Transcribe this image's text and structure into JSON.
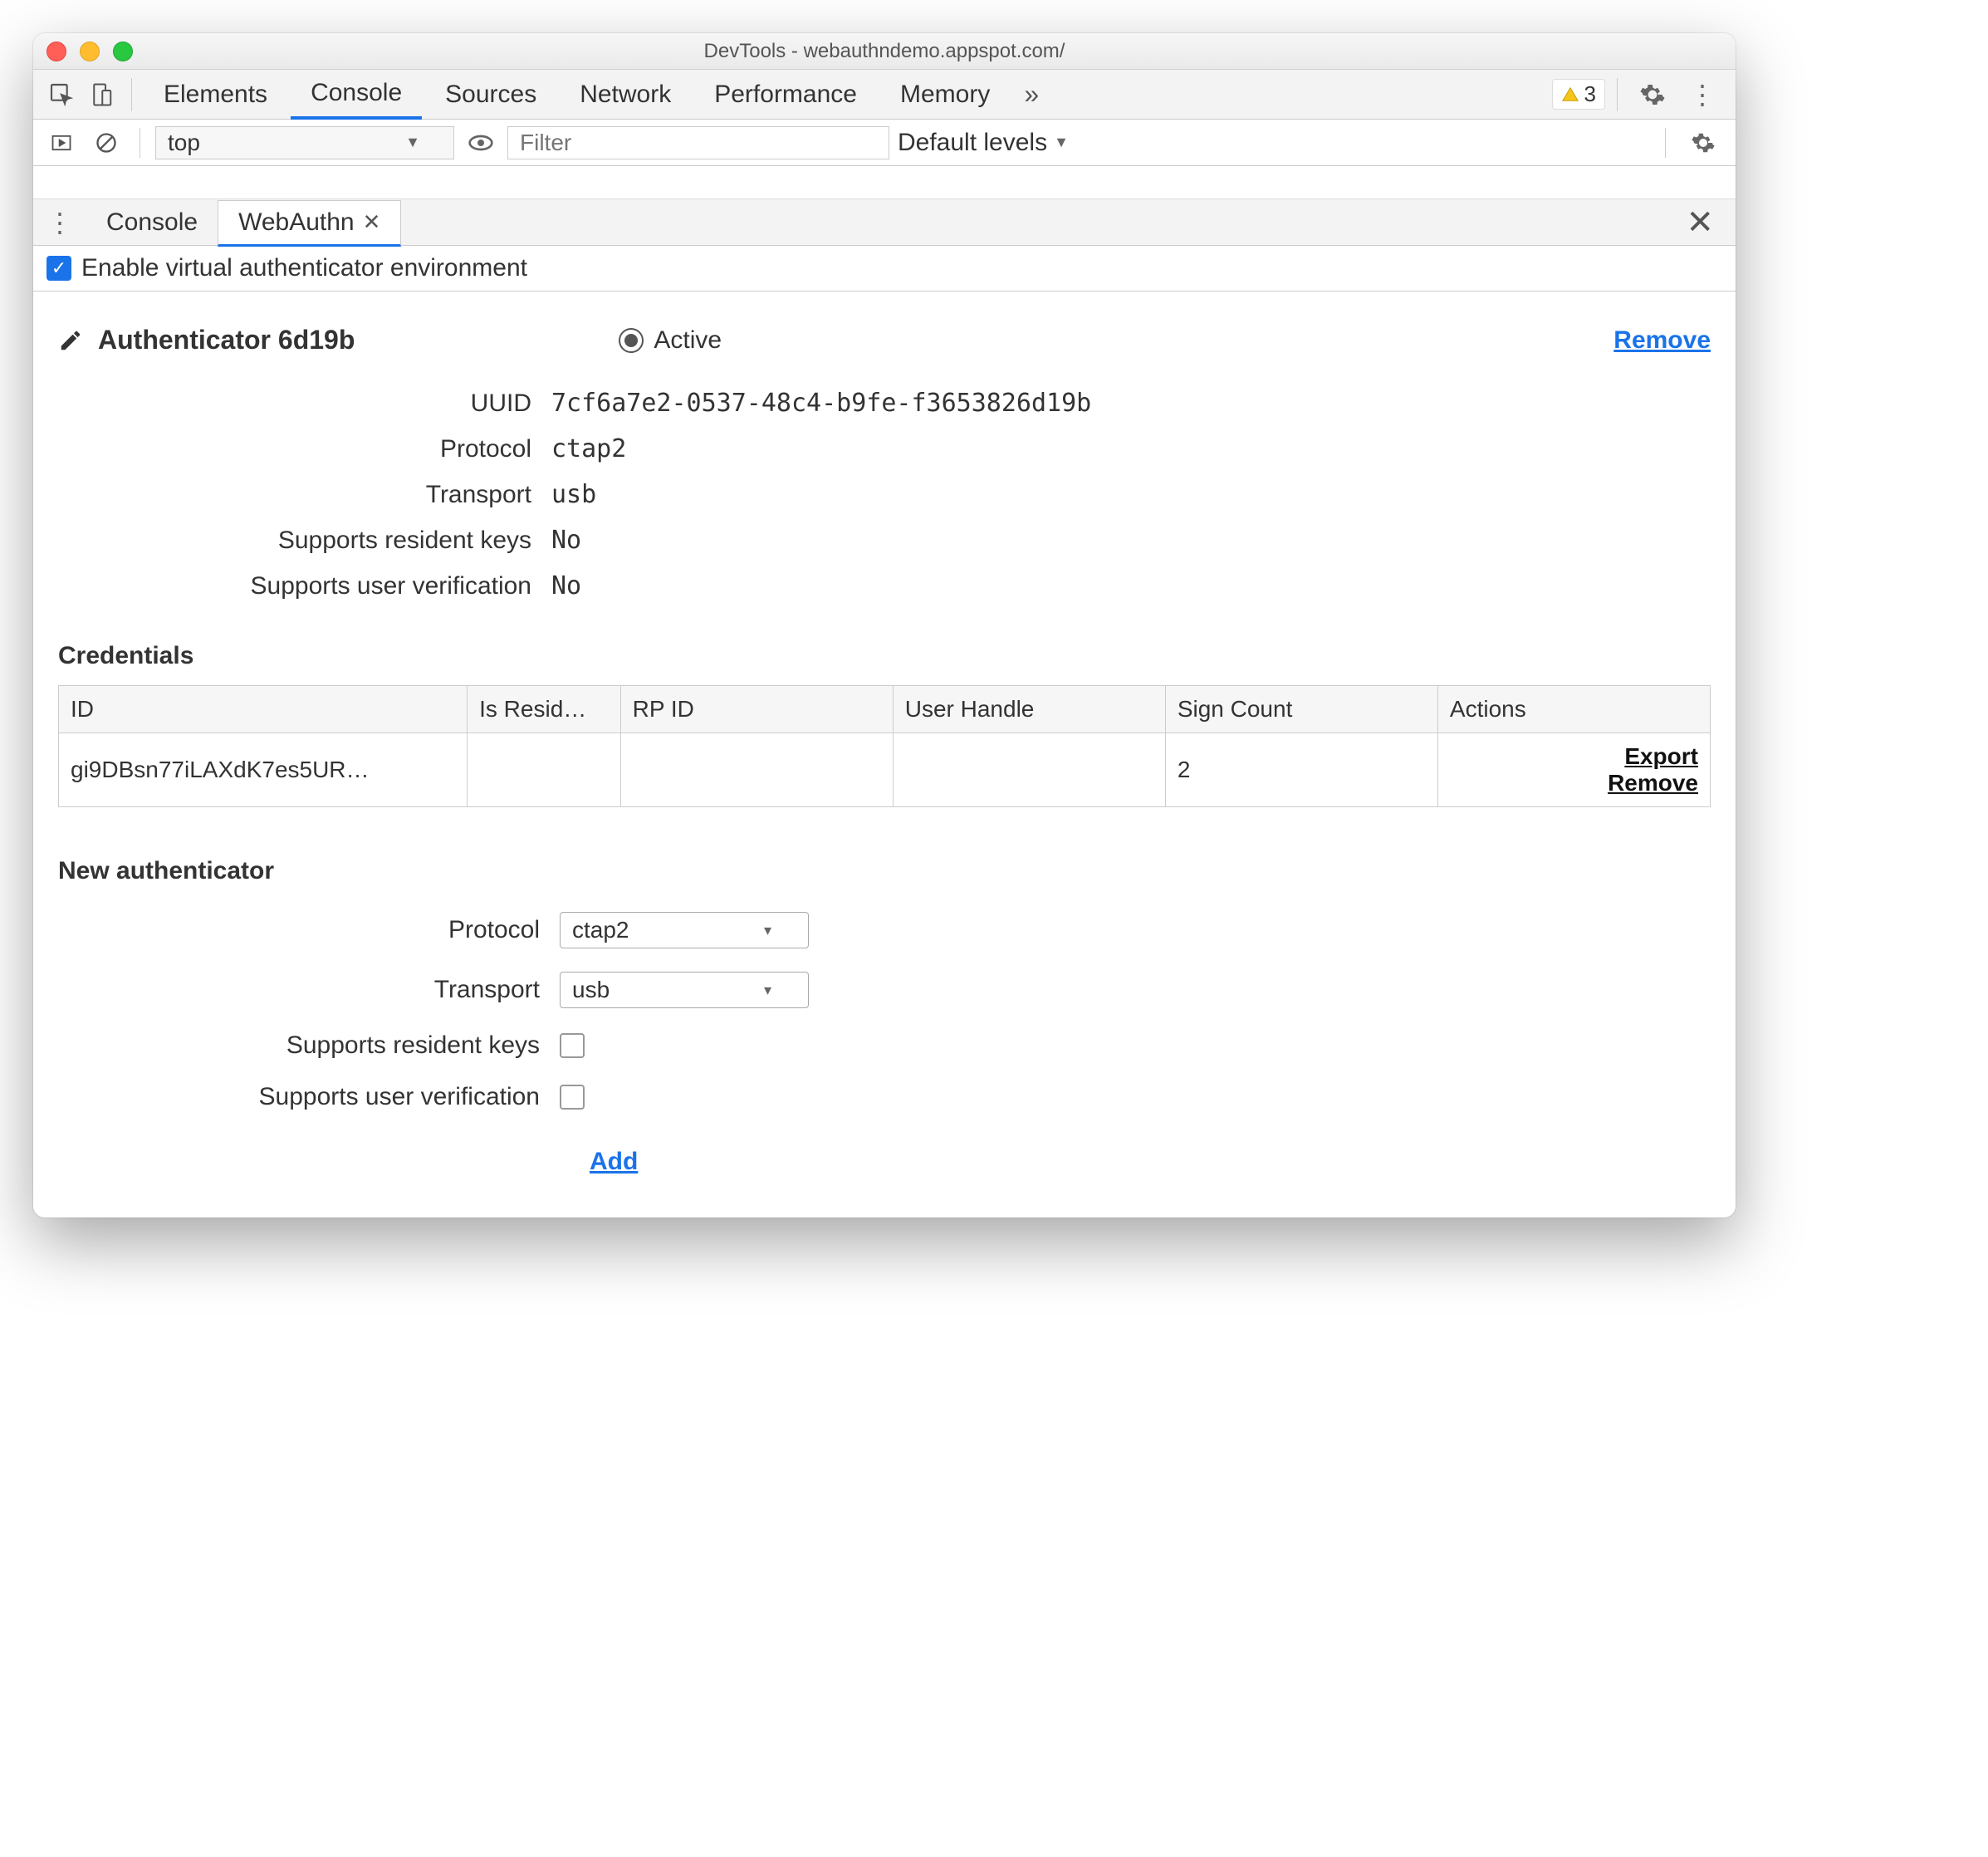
{
  "window": {
    "title": "DevTools - webauthndemo.appspot.com/"
  },
  "mainTabs": {
    "elements": "Elements",
    "console": "Console",
    "sources": "Sources",
    "network": "Network",
    "performance": "Performance",
    "memory": "Memory"
  },
  "warningCount": "3",
  "consoleToolbar": {
    "context": "top",
    "filterPlaceholder": "Filter",
    "levels": "Default levels"
  },
  "drawer": {
    "tabConsole": "Console",
    "tabWebAuthn": "WebAuthn"
  },
  "enableLabel": "Enable virtual authenticator environment",
  "authenticator": {
    "title": "Authenticator 6d19b",
    "activeLabel": "Active",
    "removeLabel": "Remove",
    "props": {
      "uuidLabel": "UUID",
      "uuid": "7cf6a7e2-0537-48c4-b9fe-f3653826d19b",
      "protocolLabel": "Protocol",
      "protocol": "ctap2",
      "transportLabel": "Transport",
      "transport": "usb",
      "residentLabel": "Supports resident keys",
      "resident": "No",
      "uvLabel": "Supports user verification",
      "uv": "No"
    }
  },
  "credentials": {
    "heading": "Credentials",
    "headers": {
      "id": "ID",
      "isResident": "Is Resid…",
      "rpid": "RP ID",
      "userHandle": "User Handle",
      "signCount": "Sign Count",
      "actions": "Actions"
    },
    "row": {
      "id": "gi9DBsn77iLAXdK7es5UR…",
      "isResident": "",
      "rpid": "",
      "userHandle": "",
      "signCount": "2",
      "export": "Export",
      "remove": "Remove"
    }
  },
  "newAuth": {
    "heading": "New authenticator",
    "protocolLabel": "Protocol",
    "protocol": "ctap2",
    "transportLabel": "Transport",
    "transport": "usb",
    "residentLabel": "Supports resident keys",
    "uvLabel": "Supports user verification",
    "addLabel": "Add"
  }
}
